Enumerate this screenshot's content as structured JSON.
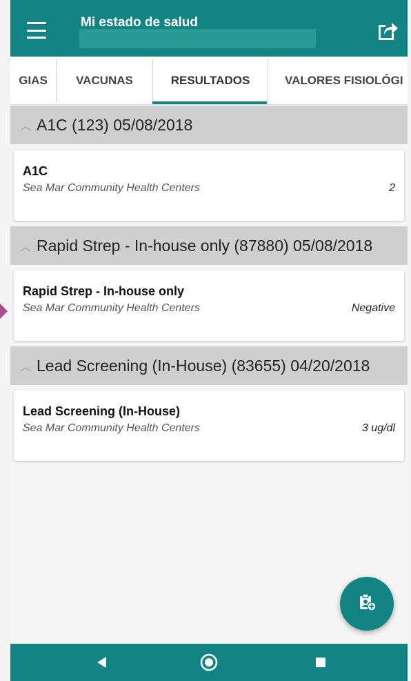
{
  "header": {
    "title": "Mi estado de salud",
    "menu_icon": "hamburger-menu-icon",
    "share_icon": "share-icon"
  },
  "tabs": [
    {
      "label": "GIAS",
      "active": false
    },
    {
      "label": "VACUNAS",
      "active": false
    },
    {
      "label": "RESULTADOS",
      "active": true
    },
    {
      "label": "VALORES FISIOLÓGI",
      "active": false
    }
  ],
  "groups": [
    {
      "header": "A1C (123) 05/08/2018",
      "item": {
        "title": "A1C",
        "provider": "Sea Mar Community Health Centers",
        "value": "2"
      }
    },
    {
      "header": "Rapid Strep - In-house only (87880) 05/08/2018",
      "item": {
        "title": "Rapid Strep - In-house only",
        "provider": "Sea Mar Community Health Centers",
        "value": "Negative"
      }
    },
    {
      "header": "Lead Screening (In-House) (83655) 04/20/2018",
      "item": {
        "title": "Lead Screening (In-House)",
        "provider": "Sea Mar Community Health Centers",
        "value": "3 ug/dl"
      }
    }
  ],
  "fab": {
    "icon": "add-clipboard-icon"
  },
  "colors": {
    "primary": "#138484",
    "group_header": "#cfcfcf",
    "accent_marker": "#b04a8a"
  }
}
